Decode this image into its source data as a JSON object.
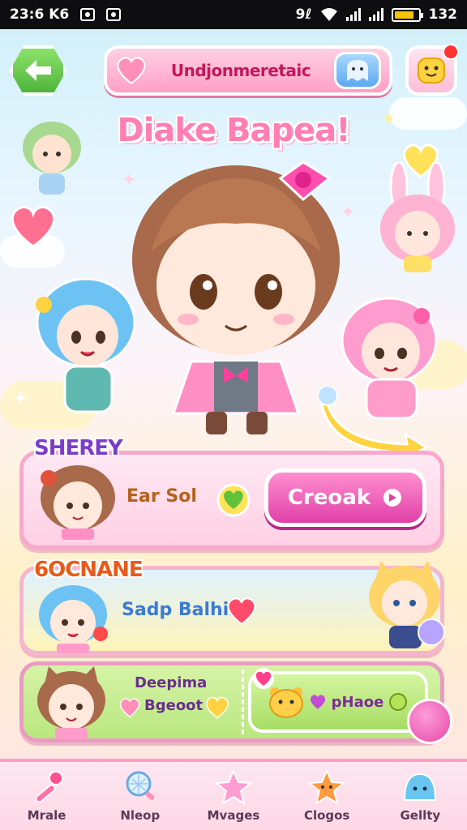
{
  "status_bar": {
    "time": "23:6 K6",
    "signal_text": "9ℓ",
    "battery_level": "132",
    "battery_fill_fraction": 0.85
  },
  "header": {
    "title": "Undjonmeretaic",
    "headline": "Diake Bapea!"
  },
  "panels": [
    {
      "label": "SHEREY",
      "text": "Ear Sol",
      "button_label": "Creoak"
    },
    {
      "label": "6OCNANE",
      "text": "Sadp Balhin"
    },
    {
      "text_top": "Deepima",
      "text_bottom": "Bgeoot",
      "button_label": "pHaoe"
    }
  ],
  "bottom_nav": [
    {
      "label": "Mrale",
      "icon": "wand-icon"
    },
    {
      "label": "Nleop",
      "icon": "magnifier-icon"
    },
    {
      "label": "Mvages",
      "icon": "star-icon"
    },
    {
      "label": "Clogos",
      "icon": "star-face-icon"
    },
    {
      "label": "Gellty",
      "icon": "slime-icon"
    }
  ],
  "colors": {
    "accent_pink": "#ff7eb3",
    "create_button": "#e040a8",
    "back_button": "#4fb43c",
    "label_purple": "#7c3cc9",
    "label_orange": "#e85a1a"
  }
}
